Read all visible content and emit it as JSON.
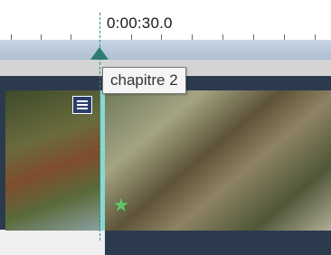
{
  "timeline": {
    "playhead_time": "0:00:30.0",
    "tooltip_text": "chapitre 2",
    "chapter_marker_icon": "star-icon",
    "clip_menu_icon": "menu-icon",
    "colors": {
      "playhead": "#2f7d72",
      "track_background": "#2c3a4e",
      "tooltip_background": "#f5f5f5"
    }
  }
}
